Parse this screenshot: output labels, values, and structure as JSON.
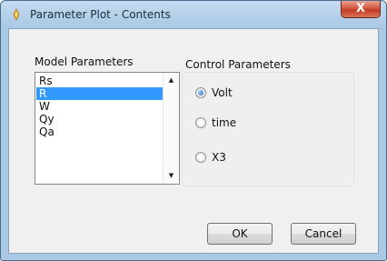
{
  "window": {
    "title": "Parameter Plot - Contents",
    "close_label": "X"
  },
  "model_parameters": {
    "label": "Model Parameters",
    "items": [
      "Rs",
      "R",
      "W",
      "Qy",
      "Qa"
    ],
    "selected": "R"
  },
  "control_parameters": {
    "label": "Control Parameters",
    "options": [
      "Volt",
      "time",
      "X3"
    ],
    "selected": "Volt"
  },
  "buttons": {
    "ok_label": "OK",
    "cancel_label": "Cancel"
  },
  "colors": {
    "selection": "#3399ff",
    "titlebar": "#a9c8e5",
    "close_button": "#c23b21"
  },
  "icons": {
    "title": "parameter-plot-app-icon",
    "scroll_up": "scroll-up-arrow-icon",
    "scroll_down": "scroll-down-arrow-icon"
  }
}
